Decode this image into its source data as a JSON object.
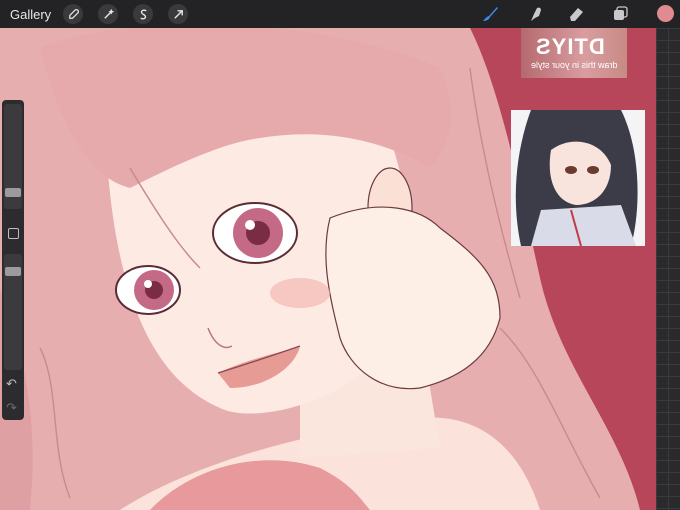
{
  "topbar": {
    "gallery_label": "Gallery",
    "left_tools": [
      "wrench-icon",
      "magic-wand-icon",
      "selection-icon",
      "transform-arrow-icon"
    ],
    "right_tools": [
      "brush-icon",
      "smudge-icon",
      "eraser-icon",
      "layers-icon"
    ],
    "active_tool": "brush-icon",
    "current_color": "#e08b8f"
  },
  "sidebar": {
    "brush_size_level": 0.88,
    "opacity_level": 0.12,
    "undo_symbol": "↶",
    "redo_symbol": "↷"
  },
  "reference_images": {
    "banner_title": "DTIYS",
    "banner_subtitle": "draw this in your style"
  },
  "colors": {
    "canvas_background": "#b7465b",
    "toolbar": "#232325",
    "accent_blue": "#3a8df0"
  }
}
